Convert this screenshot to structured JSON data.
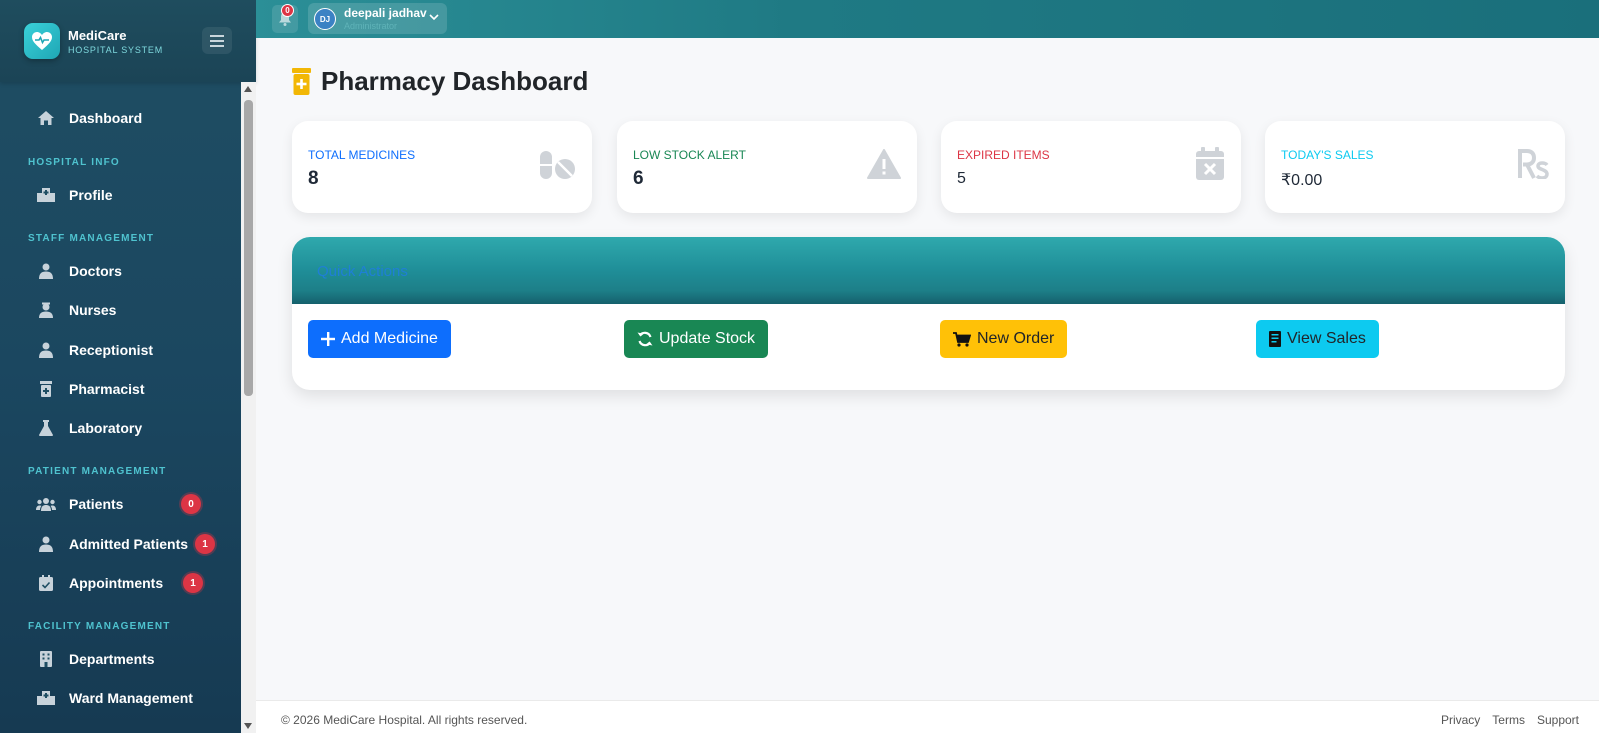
{
  "brand": {
    "name": "MediCare",
    "subtitle": "HOSPITAL SYSTEM"
  },
  "topbar": {
    "notification_count": "0",
    "user": {
      "initials": "DJ",
      "name": "deepali jadhav",
      "role": "Administrator"
    }
  },
  "sidebar": {
    "dashboard": "Dashboard",
    "sections": {
      "hospital_info": "HOSPITAL INFO",
      "staff_management": "STAFF MANAGEMENT",
      "patient_management": "PATIENT MANAGEMENT",
      "facility_management": "FACILITY MANAGEMENT"
    },
    "items": {
      "profile": "Profile",
      "doctors": "Doctors",
      "nurses": "Nurses",
      "receptionist": "Receptionist",
      "pharmacist": "Pharmacist",
      "laboratory": "Laboratory",
      "patients": "Patients",
      "admitted_patients": "Admitted Patients",
      "appointments": "Appointments",
      "departments": "Departments",
      "ward_management": "Ward Management"
    },
    "badges": {
      "patients": "0",
      "admitted_patients": "1",
      "appointments": "1"
    }
  },
  "page": {
    "title": "Pharmacy Dashboard"
  },
  "stats": [
    {
      "label": "TOTAL MEDICINES",
      "value": "8",
      "color": "#0d6efd",
      "icon": "pills-icon"
    },
    {
      "label": "LOW STOCK ALERT",
      "value": "6",
      "color": "#198754",
      "icon": "warning-icon"
    },
    {
      "label": "EXPIRED ITEMS",
      "value": "5",
      "color": "#dc3545",
      "icon": "calendar-x-icon"
    },
    {
      "label": "TODAY'S SALES",
      "value": "₹0.00",
      "color": "#0dcaf0",
      "icon": "rupee-icon"
    }
  ],
  "quick_actions": {
    "title": "Quick Actions",
    "buttons": [
      {
        "label": "Add Medicine",
        "icon": "plus-icon",
        "color": "#0d6efd"
      },
      {
        "label": "Update Stock",
        "icon": "sync-icon",
        "color": "#198754"
      },
      {
        "label": "New Order",
        "icon": "cart-icon",
        "color": "#ffc107"
      },
      {
        "label": "View Sales",
        "icon": "receipt-icon",
        "color": "#0dcaf0"
      }
    ]
  },
  "footer": {
    "copyright": "© 2026 MediCare Hospital. All rights reserved.",
    "links": {
      "privacy": "Privacy",
      "terms": "Terms",
      "support": "Support"
    }
  }
}
